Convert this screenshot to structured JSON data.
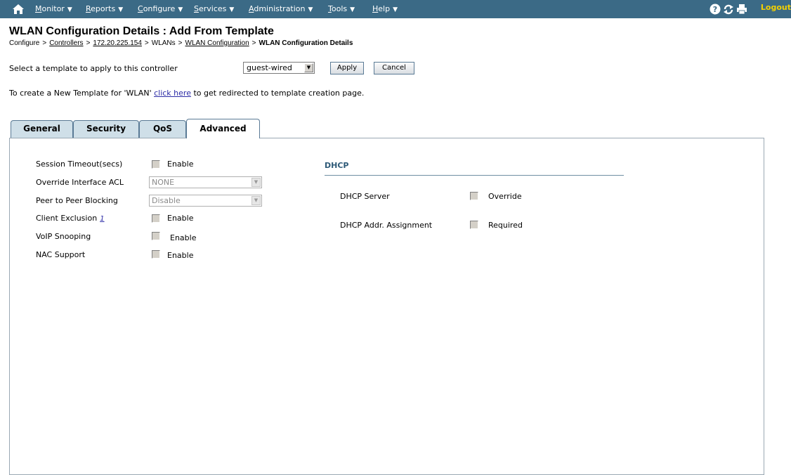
{
  "nav": {
    "items": [
      {
        "first": "M",
        "rest": "onitor"
      },
      {
        "first": "R",
        "rest": "eports"
      },
      {
        "first": "C",
        "rest": "onfigure"
      },
      {
        "first": "S",
        "rest": "ervices"
      },
      {
        "first": "A",
        "rest": "dministration"
      },
      {
        "first": "T",
        "rest": "ools"
      },
      {
        "first": "H",
        "rest": "elp"
      }
    ],
    "logout": "Logout"
  },
  "title": "WLAN Configuration Details  : Add From Template",
  "breadcrumb": {
    "items": [
      "Configure",
      "Controllers",
      "172.20.225.154",
      "WLANs",
      "WLAN Configuration",
      "WLAN Configuration Details"
    ],
    "sep": ">"
  },
  "template": {
    "label": "Select a template to apply to this controller",
    "selected": "guest-wired",
    "apply": "Apply",
    "cancel": "Cancel"
  },
  "create_line": {
    "before": "To create a New Template for 'WLAN' ",
    "link": "click here",
    "after": " to get redirected to template creation page."
  },
  "tabs": [
    "General",
    "Security",
    "QoS",
    "Advanced"
  ],
  "advanced": {
    "session_timeout": {
      "label": "Session Timeout(secs)",
      "option": "Enable"
    },
    "override_acl": {
      "label": "Override Interface ACL",
      "value": "NONE"
    },
    "p2p_blocking": {
      "label": "Peer to Peer Blocking",
      "value": "Disable"
    },
    "client_exclusion": {
      "label": "Client Exclusion",
      "info": "1",
      "option": "Enable"
    },
    "voip_snooping": {
      "label": "VoIP Snooping",
      "option": "Enable"
    },
    "nac_support": {
      "label": "NAC Support",
      "option": "Enable"
    }
  },
  "dhcp": {
    "heading": "DHCP",
    "server": {
      "label": "DHCP Server",
      "option": "Override"
    },
    "addr_assignment": {
      "label": "DHCP Addr. Assignment",
      "option": "Required"
    }
  }
}
